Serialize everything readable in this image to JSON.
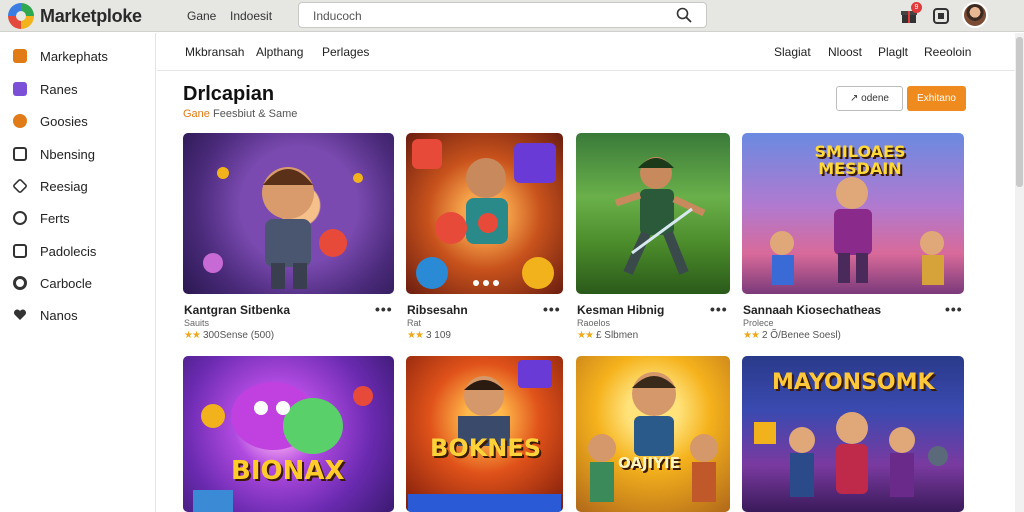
{
  "header": {
    "brand": "Marketploke",
    "nav": [
      "Gane",
      "Indoesit"
    ],
    "search_placeholder": "Inducoch",
    "notification_count": "9"
  },
  "sidebar": {
    "items": [
      {
        "label": "Markephats",
        "icon": "storefront-icon",
        "color": "#e07b17"
      },
      {
        "label": "Ranes",
        "icon": "games-icon",
        "color": "#7b4fd6"
      },
      {
        "label": "Goosies",
        "icon": "gamepad-icon",
        "color": "#e07b17"
      },
      {
        "label": "Nbensing",
        "icon": "square-icon",
        "color": "#333333"
      },
      {
        "label": "Reesiag",
        "icon": "tag-icon",
        "color": "#333333"
      },
      {
        "label": "Ferts",
        "icon": "clock-icon",
        "color": "#333333"
      },
      {
        "label": "Padolecis",
        "icon": "box-icon",
        "color": "#333333"
      },
      {
        "label": "Carbocle",
        "icon": "circle-icon",
        "color": "#333333"
      },
      {
        "label": "Nanos",
        "icon": "heart-icon",
        "color": "#333333"
      }
    ]
  },
  "tabs": {
    "left": [
      "Mkbransah",
      "Alpthang",
      "Perlages"
    ],
    "right": [
      "Slagiat",
      "Nloost",
      "Plaglt",
      "Reeoloin"
    ]
  },
  "main": {
    "title": "Drlcapian",
    "subtitle_accent": "Gane",
    "subtitle_rest": "Feesbiut & Same",
    "btn_outline": "↗ odene",
    "btn_solid": "Exhitano"
  },
  "cards": [
    {
      "title": "Kantgran Sitbenka",
      "sub": "Sauits",
      "stars": "★★",
      "rating": "300Sense (500)"
    },
    {
      "title": "Ribsesahn",
      "sub": "Rat",
      "stars": "★★",
      "rating": "3 109"
    },
    {
      "title": "Kesman Hibnig",
      "sub": "Raoelos",
      "stars": "★★",
      "rating": "£ Slbmen"
    },
    {
      "title": "Sannaah Kiosechatheas",
      "sub": "Prolece",
      "stars": "★★",
      "rating": "2 Õ/Benee Soesl)"
    }
  ],
  "card_art_text": [
    "SMILOAES MESDAIN",
    "BIONAX",
    "BOKNES",
    "OAJIYIE",
    "MAYONSOMK"
  ]
}
